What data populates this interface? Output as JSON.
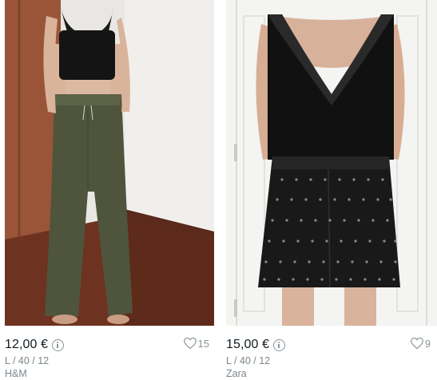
{
  "items": [
    {
      "price": "12,00 €",
      "size": "L / 40 / 12",
      "brand": "H&M",
      "favorites": "15"
    },
    {
      "price": "15,00 €",
      "size": "L / 40 / 12",
      "brand": "Zara",
      "favorites": "9"
    }
  ],
  "colors": {
    "price_text": "#111b22",
    "muted_text": "#7c878d",
    "icon": "#8a9499"
  },
  "icons": {
    "info": "info-circle-icon",
    "favorite": "heart-outline-icon"
  }
}
